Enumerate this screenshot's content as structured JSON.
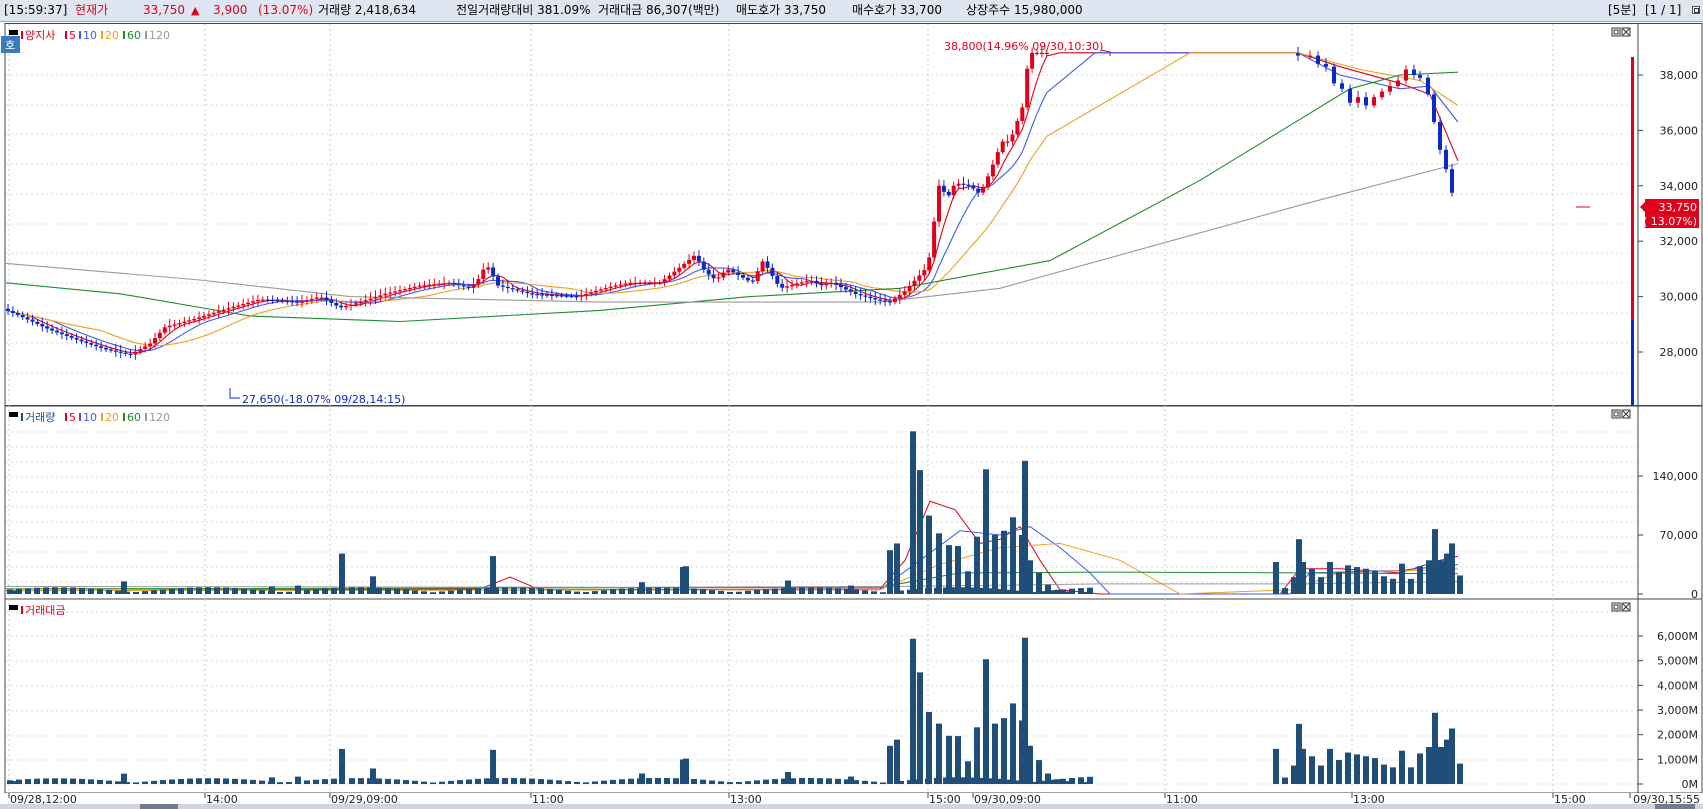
{
  "topbar": {
    "time": "[15:59:37]",
    "price_label": "현재가",
    "price": "33,750",
    "change_arrow": "▲",
    "change": "3,900",
    "change_pct": "(13.07%)",
    "volume": "거래량 2,418,634",
    "vs_prev": "전일거래량대비 381.09%",
    "amount": "거래대금 86,307(백만)",
    "ask": "매도호가 33,750",
    "bid": "매수호가 33,700",
    "listed": "상장주수 15,980,000",
    "period": "[5분]",
    "page": "[1 / 1]"
  },
  "colors": {
    "up": "#e0001b",
    "down": "#0b28c8",
    "ma5": "#e0001b",
    "ma10": "#3d5bf0",
    "ma20": "#f0a020",
    "ma60": "#1f8a34",
    "ma120": "#9a9a9a",
    "bar": "#1f4e79"
  },
  "legends": {
    "price_badge": "호",
    "price_title": "양지사",
    "volume_title": "거래량",
    "amount_title": "거래대금",
    "ma": [
      "5",
      "10",
      "20",
      "60",
      "120"
    ]
  },
  "annotations": {
    "high": "38,800(14.96% 09/30,10:30)",
    "low": "27,650(-18.07% 09/28,14:15)",
    "current_price": "33,750",
    "current_pct": "( 13.07%)"
  },
  "chart_data": [
    {
      "type": "candlestick",
      "title": "양지사",
      "y_ticks": [
        "38,000",
        "36,000",
        "34,000",
        "32,000",
        "30,000",
        "28,000"
      ],
      "ylim": [
        27300,
        39400
      ],
      "anchors": {
        "x": [
          0,
          20,
          50,
          80,
          105,
          130,
          150,
          165,
          195,
          230,
          260,
          300,
          320,
          340,
          360,
          385,
          420,
          450,
          470,
          480,
          486,
          498,
          530,
          578,
          595,
          615,
          630,
          660,
          678,
          695,
          705,
          716,
          727,
          742,
          752,
          763,
          780,
          800,
          810,
          820,
          832,
          855,
          875,
          890,
          905,
          928,
          939,
          948,
          955,
          970,
          980,
          990,
          1002,
          1010,
          1023,
          1029,
          1049
        ],
        "close": [
          29600,
          29300,
          28800,
          28400,
          28100,
          27900,
          28300,
          28900,
          29200,
          29600,
          29900,
          29800,
          30000,
          29600,
          29800,
          30100,
          30400,
          30500,
          30300,
          30700,
          31200,
          30400,
          30100,
          30000,
          30200,
          30400,
          30500,
          30500,
          31000,
          31500,
          30900,
          30600,
          31000,
          30700,
          30500,
          31300,
          30300,
          30500,
          30600,
          30400,
          30500,
          30100,
          29900,
          29800,
          30200,
          31100,
          34000,
          33600,
          34100,
          34000,
          33700,
          34500,
          35600,
          35600,
          36900,
          38800,
          38800
        ]
      },
      "high": "38,800 (09/30 10:30)",
      "low": "27,650 (09/28 14:15)",
      "last": 33750
    },
    {
      "type": "bar",
      "title": "거래량",
      "y_ticks": [
        "140,000",
        "70,000",
        "0"
      ],
      "ylim": [
        0,
        200000
      ],
      "bars": [
        [
          14,
          4000
        ],
        [
          124,
          15000
        ],
        [
          272,
          9000
        ],
        [
          298,
          10000
        ],
        [
          342,
          48000
        ],
        [
          373,
          21000
        ],
        [
          493,
          45000
        ],
        [
          642,
          14000
        ],
        [
          683,
          32000
        ],
        [
          686,
          33000
        ],
        [
          788,
          16000
        ],
        [
          851,
          10000
        ],
        [
          890,
          52000
        ],
        [
          897,
          60000
        ],
        [
          913,
          193000
        ],
        [
          920,
          147000
        ],
        [
          929,
          93000
        ],
        [
          939,
          72000
        ],
        [
          949,
          58000
        ],
        [
          958,
          57000
        ],
        [
          968,
          27000
        ],
        [
          977,
          68000
        ],
        [
          986,
          148000
        ],
        [
          995,
          70000
        ],
        [
          1004,
          75000
        ],
        [
          1013,
          91000
        ],
        [
          1022,
          70000
        ],
        [
          1025,
          158000
        ],
        [
          1030,
          40000
        ],
        [
          1039,
          25000
        ],
        [
          1048,
          11000
        ],
        [
          1057,
          5000
        ],
        [
          1066,
          3000
        ],
        [
          1084,
          2000
        ],
        [
          1276,
          38000
        ],
        [
          1285,
          7000
        ],
        [
          1294,
          20000
        ],
        [
          1299,
          65000
        ],
        [
          1303,
          38000
        ],
        [
          1312,
          30000
        ],
        [
          1321,
          20000
        ],
        [
          1330,
          38000
        ],
        [
          1339,
          26000
        ],
        [
          1348,
          34000
        ],
        [
          1357,
          32000
        ],
        [
          1366,
          30000
        ],
        [
          1375,
          28000
        ],
        [
          1384,
          21000
        ],
        [
          1393,
          18000
        ],
        [
          1402,
          36000
        ],
        [
          1411,
          18000
        ],
        [
          1420,
          33000
        ],
        [
          1429,
          40000
        ],
        [
          1435,
          77000
        ],
        [
          1441,
          40000
        ],
        [
          1447,
          48000
        ],
        [
          1452,
          60000
        ],
        [
          1460,
          22000
        ]
      ]
    },
    {
      "type": "bar",
      "title": "거래대금",
      "y_ticks": [
        "6,000M",
        "5,000M",
        "4,000M",
        "3,000M",
        "2,000M",
        "1,000M",
        "0M"
      ],
      "ylim": [
        0,
        7000
      ]
    }
  ],
  "x_axis": {
    "labels": [
      "09/28,12:00",
      "14:00",
      "09/29,09:00",
      "11:00",
      "13:00",
      "15:00",
      "09/30,09:00",
      "11:00",
      "13:00",
      "15:00",
      "09/30,15:55"
    ]
  }
}
